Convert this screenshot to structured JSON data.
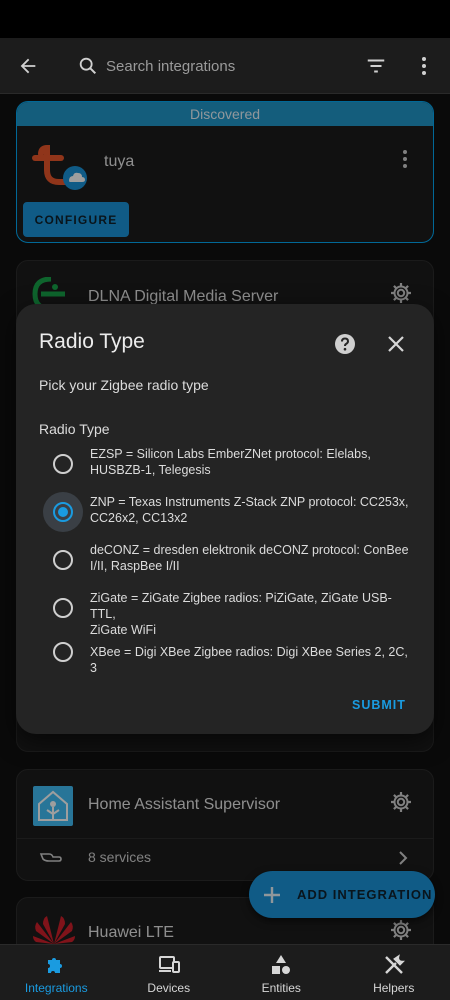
{
  "appbar": {
    "search_placeholder": "Search integrations"
  },
  "discovered": {
    "banner": "Discovered",
    "name": "tuya",
    "configure_label": "CONFIGURE"
  },
  "cards": {
    "dlna": {
      "title": "DLNA Digital Media Server"
    },
    "ha": {
      "title": "Home Assistant Supervisor",
      "services": "8 services"
    },
    "huawei": {
      "title": "Huawei LTE"
    }
  },
  "dialog": {
    "title": "Radio Type",
    "description": "Pick your Zigbee radio type",
    "group_label": "Radio Type",
    "options": [
      {
        "line1": "EZSP = Silicon Labs EmberZNet protocol: Elelabs,",
        "line2": "HUSBZB-1, Telegesis",
        "selected": false
      },
      {
        "line1": "ZNP = Texas Instruments Z-Stack ZNP protocol: CC253x,",
        "line2": "CC26x2, CC13x2",
        "selected": true
      },
      {
        "line1": "deCONZ = dresden elektronik deCONZ protocol: ConBee",
        "line2": "I/II, RaspBee I/II",
        "selected": false
      },
      {
        "line1": "ZiGate = ZiGate Zigbee radios: PiZiGate, ZiGate USB-TTL,",
        "line2": "ZiGate WiFi",
        "selected": false
      },
      {
        "line1": "XBee = Digi XBee Zigbee radios: Digi XBee Series 2, 2C, 3",
        "line2": "",
        "selected": false
      }
    ],
    "submit_label": "SUBMIT"
  },
  "fab": {
    "label": "ADD INTEGRATION"
  },
  "nav": {
    "items": [
      {
        "label": "Integrations",
        "active": true
      },
      {
        "label": "Devices",
        "active": false
      },
      {
        "label": "Entities",
        "active": false
      },
      {
        "label": "Helpers",
        "active": false
      }
    ]
  },
  "colors": {
    "accent": "#1a93d8",
    "tuya": "#e8562a",
    "dlna": "#17a34a",
    "huawei": "#cf1f2a"
  }
}
